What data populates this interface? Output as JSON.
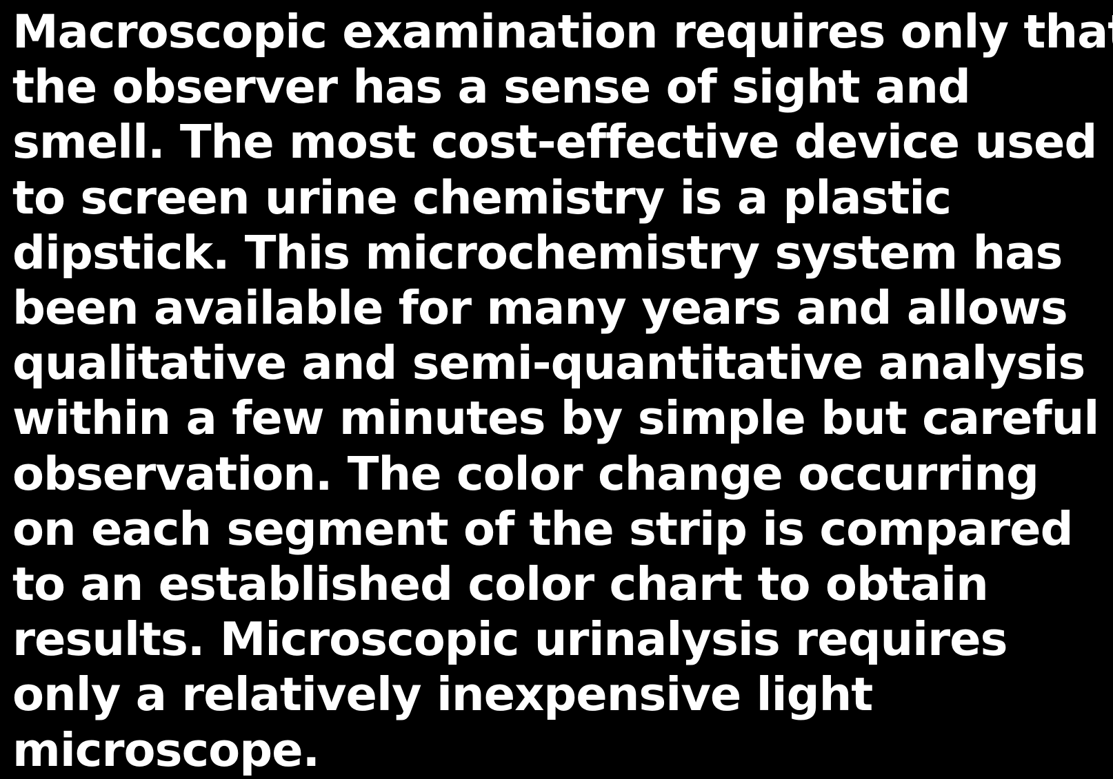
{
  "document": {
    "background_color": "#000000",
    "text_color": "#ffffff",
    "lines": [
      "Macroscopic examination requires only that",
      "the observer has a sense of sight and",
      "smell. The most cost-effective device used",
      "to screen urine chemistry is a plastic",
      "dipstick. This microchemistry system has",
      "been available for many years and allows",
      "qualitative and semi-quantitative analysis",
      "within a few minutes by simple but careful",
      "observation. The color change occurring",
      "on each segment of the strip is compared",
      "to an established color chart to obtain",
      "results. Microscopic urinalysis requires",
      "only a relatively inexpensive light",
      "microscope."
    ]
  }
}
